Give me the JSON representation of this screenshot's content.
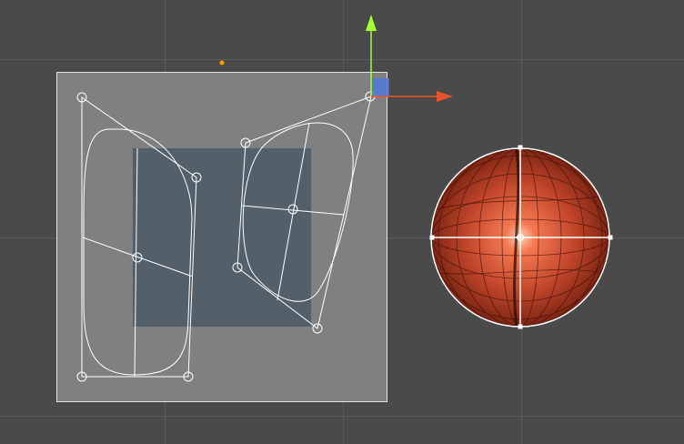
{
  "scene": {
    "background_color": "#4a4a4a",
    "grid_color": "#5a5a5a",
    "panel_color": "#808080",
    "panel_border_color": "#e6e6e6",
    "mask_rect_color": "#536069",
    "curve_color": "#ffffff",
    "origin_dot_color": "#ff9900"
  },
  "gizmo": {
    "y_axis_color": "#a6ff33",
    "x_axis_color": "#e8542a",
    "plane_handle_color": "#4f79d6"
  },
  "sphere": {
    "base_color": "#c2462a",
    "highlight_color": "#ffd0b8",
    "outline_color": "#ffffff"
  }
}
